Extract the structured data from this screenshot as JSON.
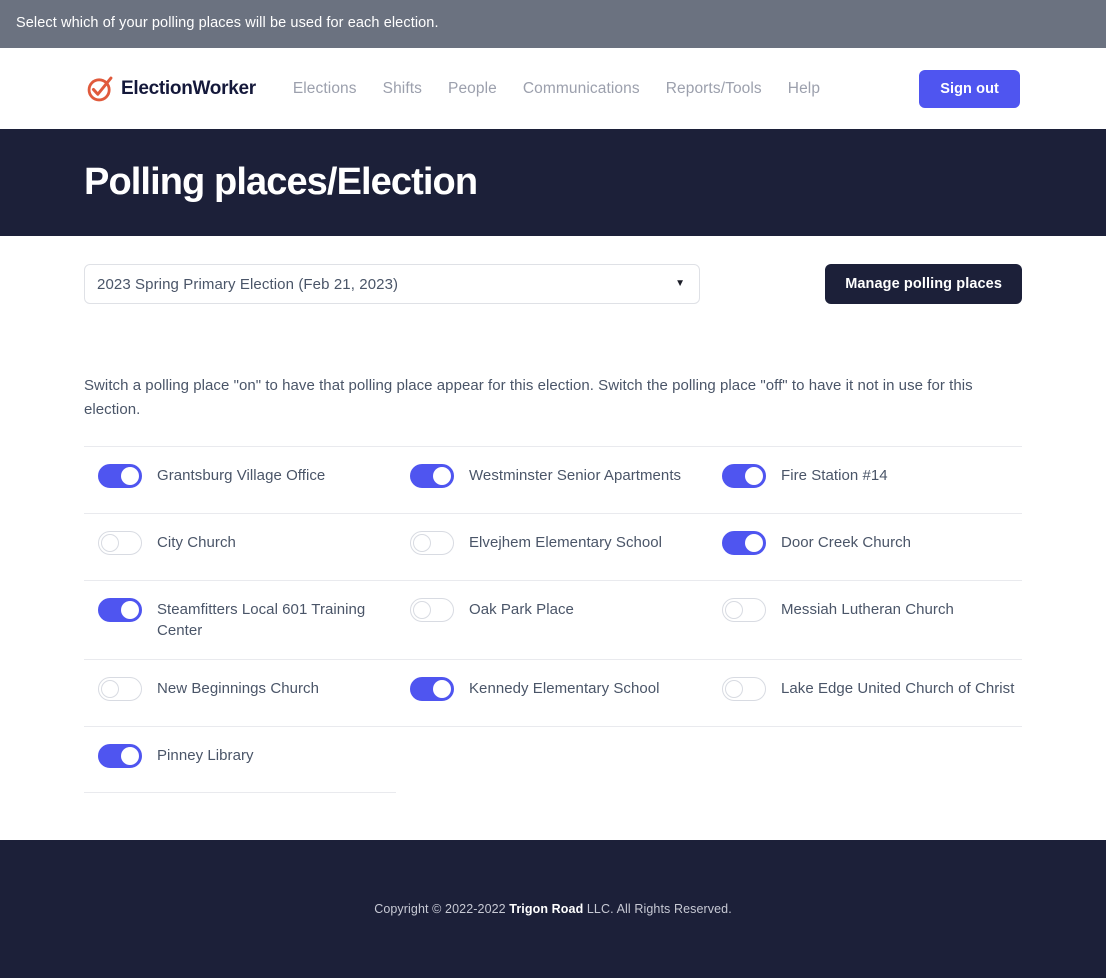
{
  "notice": {
    "text": "Select which of your polling places will be used for each election."
  },
  "nav": {
    "brand": "ElectionWorker",
    "links": [
      {
        "label": "Elections"
      },
      {
        "label": "Shifts"
      },
      {
        "label": "People"
      },
      {
        "label": "Communications"
      },
      {
        "label": "Reports/Tools"
      },
      {
        "label": "Help"
      }
    ],
    "signout_label": "Sign out"
  },
  "header": {
    "title": "Polling places/Election"
  },
  "controls": {
    "election_select_value": "2023 Spring Primary Election (Feb 21, 2023)",
    "election_select_caret": "▼",
    "manage_button_label": "Manage polling places"
  },
  "instructions": "Switch a polling place \"on\" to have that polling place appear for this election. Switch the polling place \"off\" to have it not in use for this election.",
  "polling_places": [
    {
      "name": "Grantsburg Village Office",
      "on": true
    },
    {
      "name": "Westminster Senior Apartments",
      "on": true
    },
    {
      "name": "Fire Station #14",
      "on": true
    },
    {
      "name": "City Church",
      "on": false
    },
    {
      "name": "Elvejhem Elementary School",
      "on": false
    },
    {
      "name": "Door Creek Church",
      "on": true
    },
    {
      "name": "Steamfitters Local 601 Training Center",
      "on": true
    },
    {
      "name": "Oak Park Place",
      "on": false
    },
    {
      "name": "Messiah Lutheran Church",
      "on": false
    },
    {
      "name": "New Beginnings Church",
      "on": false
    },
    {
      "name": "Kennedy Elementary School",
      "on": true
    },
    {
      "name": "Lake Edge United Church of Christ",
      "on": false
    },
    {
      "name": "Pinney Library",
      "on": true
    }
  ],
  "footer": {
    "prefix": "Copyright © 2022-2022 ",
    "company": "Trigon Road",
    "suffix": " LLC. All Rights Reserved."
  },
  "colors": {
    "notice_bg": "#6b7280",
    "accent_indigo": "#4f55f0",
    "dark_navy": "#1c2039",
    "brand_orange": "#e05a3c",
    "text_gray": "#4a5568",
    "nav_link_gray": "#9ca0ad",
    "divider": "#e9eaee"
  }
}
